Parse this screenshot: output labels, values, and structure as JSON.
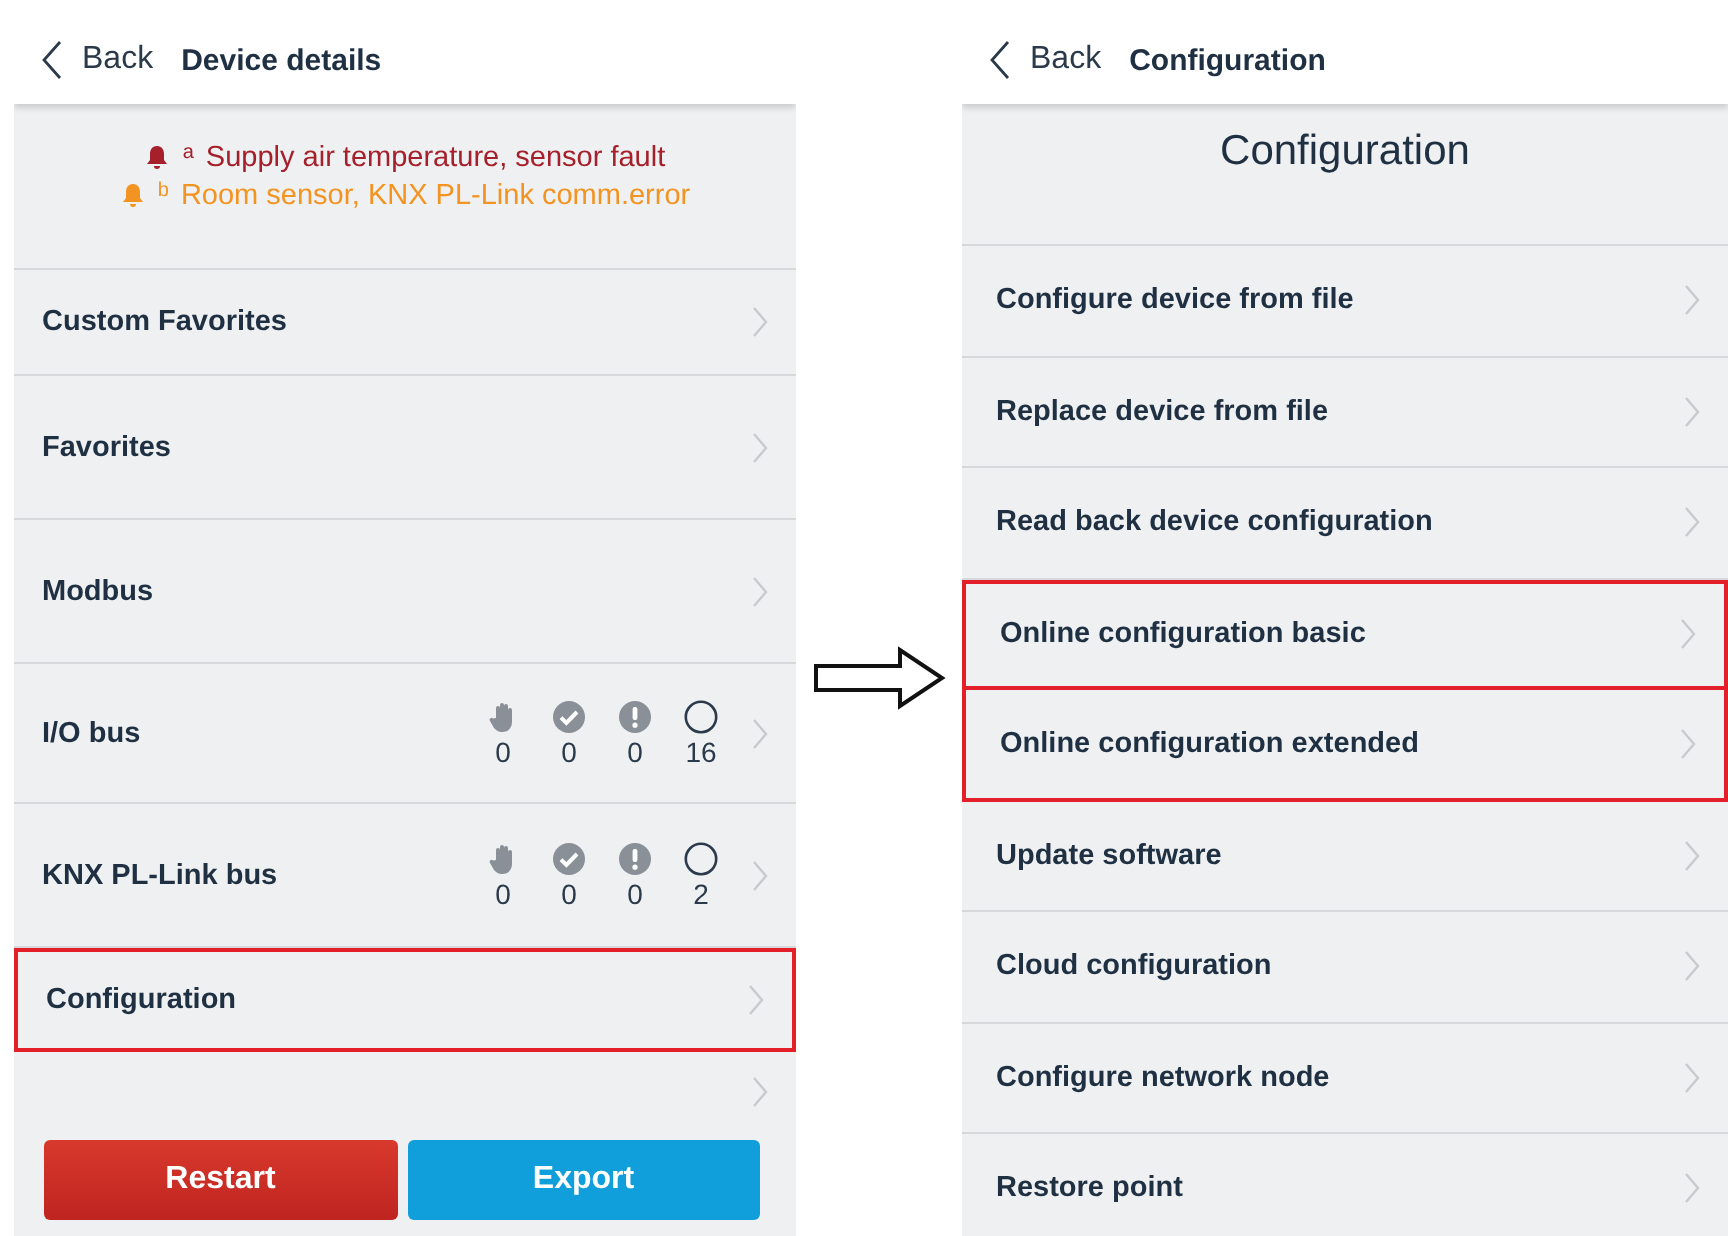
{
  "left_screen": {
    "header": {
      "back": "Back",
      "title": "Device details"
    },
    "alerts": [
      {
        "marker": "a",
        "text": "Supply air temperature, sensor fault",
        "color": "#a5202a"
      },
      {
        "marker": "b",
        "text": "Room sensor, KNX PL-Link comm.error",
        "color": "#f39321"
      }
    ],
    "items": [
      {
        "label": "Custom Favorites",
        "highlighted": false
      },
      {
        "label": "Favorites",
        "highlighted": false
      },
      {
        "label": "Modbus",
        "highlighted": false
      },
      {
        "label": "I/O bus",
        "highlighted": false,
        "counts": [
          {
            "kind": "manual",
            "value": "0"
          },
          {
            "kind": "ok",
            "value": "0"
          },
          {
            "kind": "alarm",
            "value": "0"
          },
          {
            "kind": "idle",
            "value": "16"
          }
        ]
      },
      {
        "label": "KNX PL-Link bus",
        "highlighted": false,
        "counts": [
          {
            "kind": "manual",
            "value": "0"
          },
          {
            "kind": "ok",
            "value": "0"
          },
          {
            "kind": "alarm",
            "value": "0"
          },
          {
            "kind": "idle",
            "value": "2"
          }
        ]
      },
      {
        "label": "Configuration",
        "highlighted": true
      }
    ],
    "buttons": [
      {
        "label": "Restart",
        "kind": "danger"
      },
      {
        "label": "Export",
        "kind": "primary"
      }
    ]
  },
  "right_screen": {
    "header": {
      "back": "Back",
      "title": "Configuration"
    },
    "heading": "Configuration",
    "items": [
      {
        "label": "Configure device from file",
        "highlighted": false
      },
      {
        "label": "Replace device from file",
        "highlighted": false
      },
      {
        "label": "Read back device configuration",
        "highlighted": false
      },
      {
        "label": "Online configuration basic",
        "highlighted": true
      },
      {
        "label": "Online configuration extended",
        "highlighted": true
      },
      {
        "label": "Update software",
        "highlighted": false
      },
      {
        "label": "Cloud configuration",
        "highlighted": false
      },
      {
        "label": "Configure network node",
        "highlighted": false
      },
      {
        "label": "Restore point",
        "highlighted": false
      }
    ]
  }
}
